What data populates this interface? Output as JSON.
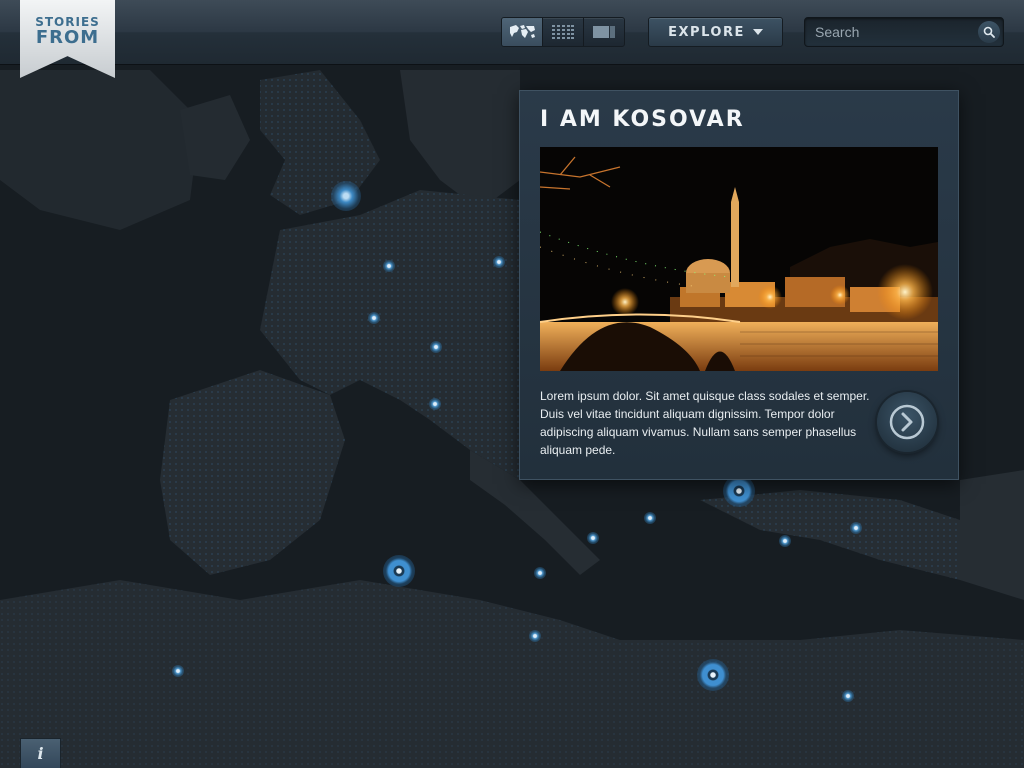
{
  "app": {
    "logo_line1": "STORIES",
    "logo_line2": "FROM"
  },
  "toolbar": {
    "view_modes": [
      {
        "name": "map",
        "icon": "world-map-icon",
        "active": true
      },
      {
        "name": "grid",
        "icon": "grid-icon",
        "active": false
      },
      {
        "name": "list",
        "icon": "list-icon",
        "active": false
      }
    ],
    "explore_label": "EXPLORE",
    "search_placeholder": "Search"
  },
  "story": {
    "title": "I AM KOSOVAR",
    "description": "Lorem ipsum dolor. Sit amet quisque class sodales et semper. Duis vel vitae tincidunt aliquam dignissim. Tempor dolor adipiscing aliquam vivamus. Nullam sans semper phasellus aliquam pede.",
    "image_subject": "night view of mosque and stone bridge"
  },
  "info_label": "i",
  "colors": {
    "accent_blue": "#3f8fd0",
    "topbar": "#2c3844",
    "card_bg": "#26343f",
    "logo_text": "#3d6e8f"
  }
}
